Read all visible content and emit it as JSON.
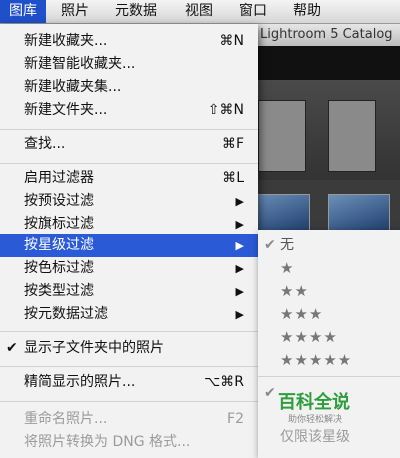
{
  "menubar": {
    "items": [
      {
        "label": "图库",
        "active": true
      },
      {
        "label": "照片"
      },
      {
        "label": "元数据"
      },
      {
        "label": "视图"
      },
      {
        "label": "窗口"
      },
      {
        "label": "帮助"
      }
    ]
  },
  "app": {
    "title": "Lightroom 5 Catalog"
  },
  "menu": {
    "items": [
      {
        "label": "新建收藏夹...",
        "shortcut": "⌘N"
      },
      {
        "label": "新建智能收藏夹..."
      },
      {
        "label": "新建收藏夹集..."
      },
      {
        "label": "新建文件夹...",
        "shortcut": "⇧⌘N"
      },
      {
        "label": "查找...",
        "shortcut": "⌘F"
      },
      {
        "label": "启用过滤器",
        "shortcut": "⌘L"
      },
      {
        "label": "按预设过滤",
        "submenu": true
      },
      {
        "label": "按旗标过滤",
        "submenu": true
      },
      {
        "label": "按星级过滤",
        "submenu": true,
        "selected": true
      },
      {
        "label": "按色标过滤",
        "submenu": true
      },
      {
        "label": "按类型过滤",
        "submenu": true
      },
      {
        "label": "按元数据过滤",
        "submenu": true
      },
      {
        "label": "显示子文件夹中的照片",
        "checked": true
      },
      {
        "label": "精简显示的照片...",
        "shortcut": "⌥⌘R"
      },
      {
        "label": "重命名照片...",
        "shortcut": "F2",
        "disabled": true
      },
      {
        "label": "将照片转换为 DNG 格式...",
        "disabled": true
      }
    ]
  },
  "submenu": {
    "items": [
      {
        "label": "无",
        "checked": true
      },
      {
        "label": "★"
      },
      {
        "label": "★★"
      },
      {
        "label": "★★★"
      },
      {
        "label": "★★★★"
      },
      {
        "label": "★★★★★"
      },
      {
        "label": "仅限该星级",
        "checked": true,
        "disabled": true
      }
    ]
  },
  "watermark": {
    "main": "百科全说",
    "sub": "助你轻松解决"
  },
  "colors": {
    "selection": "#2a5ad6",
    "menubar_active": "#1f4fc9",
    "watermark": "#2e9d3b"
  },
  "icons": {
    "check": "checkmark-icon",
    "submenu": "triangle-right-icon"
  }
}
